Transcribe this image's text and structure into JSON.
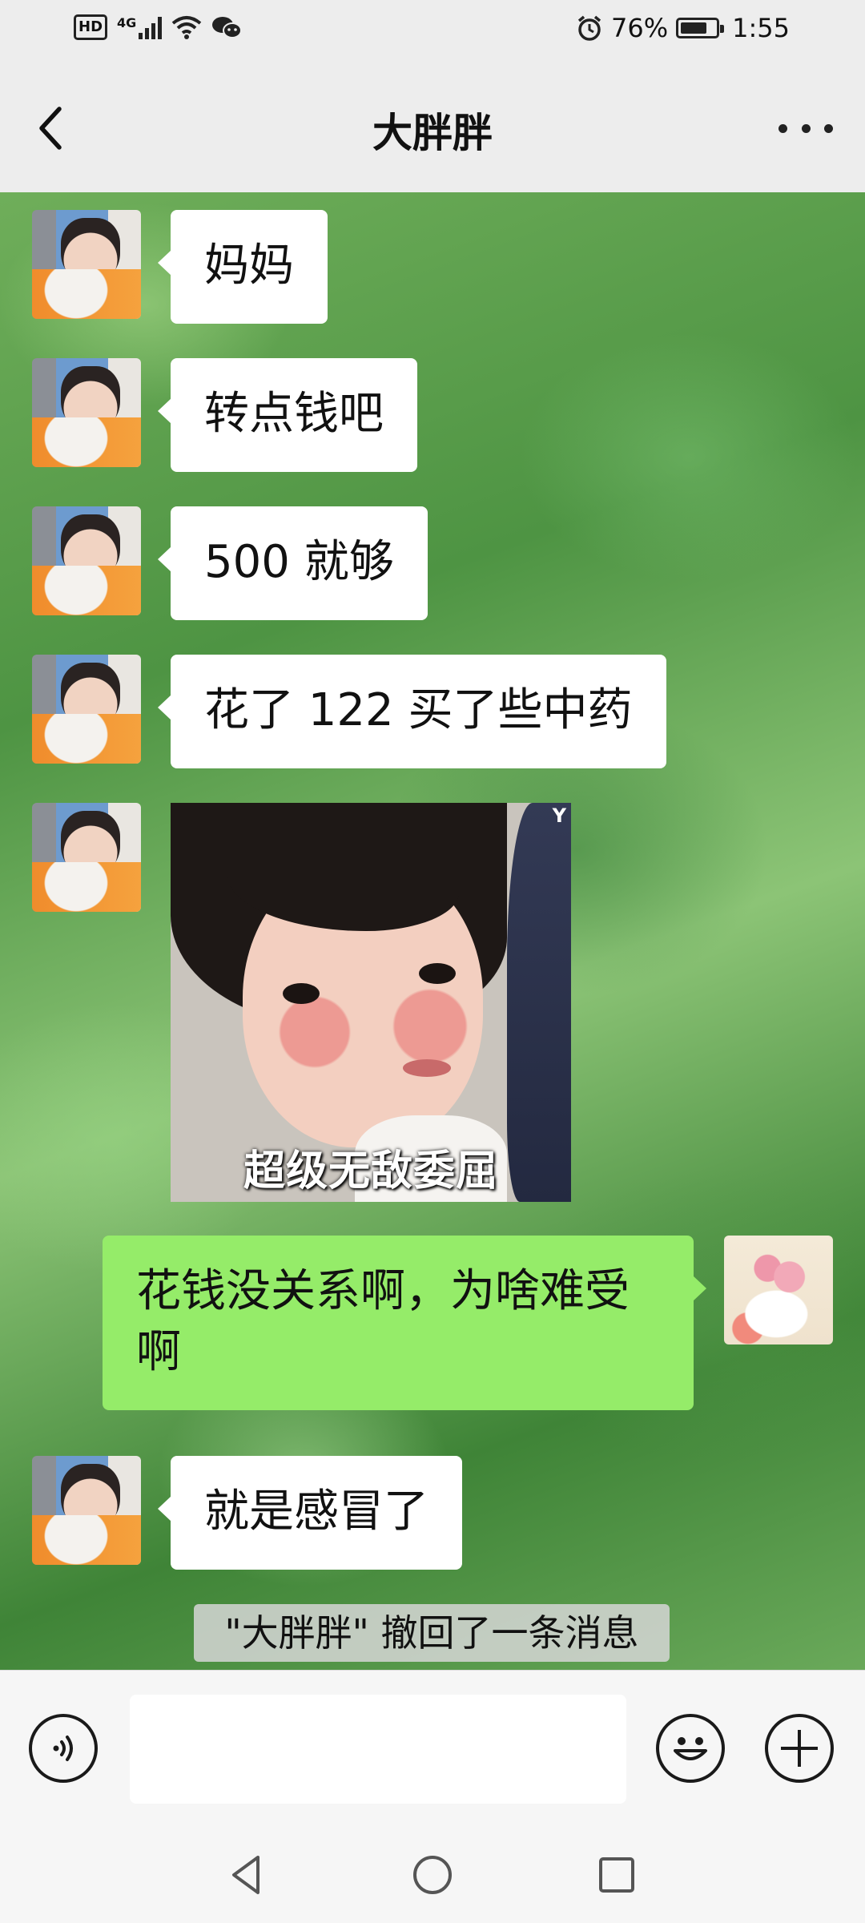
{
  "status_bar": {
    "hd_label": "HD",
    "network_label": "4G",
    "battery_percent": "76%",
    "battery_level": 0.76,
    "time": "1:55"
  },
  "nav": {
    "title": "大胖胖"
  },
  "messages": [
    {
      "sender": "them",
      "type": "text",
      "text": "妈妈"
    },
    {
      "sender": "them",
      "type": "text",
      "text": "转点钱吧"
    },
    {
      "sender": "them",
      "type": "text",
      "text": "500 就够"
    },
    {
      "sender": "them",
      "type": "text",
      "text": "花了 122 买了些中药"
    },
    {
      "sender": "them",
      "type": "sticker",
      "caption": "超级无敌委屈",
      "watermark": "Y"
    },
    {
      "sender": "me",
      "type": "text",
      "text": "花钱没关系啊，为啥难受啊"
    },
    {
      "sender": "them",
      "type": "text",
      "text": "就是感冒了"
    }
  ],
  "system_notice": "\"大胖胖\" 撤回了一条消息",
  "input_bar": {
    "text_value": "",
    "icons": [
      "voice-icon",
      "emoji-icon",
      "plus-icon"
    ]
  },
  "system_nav": {
    "icons": [
      "back-triangle-icon",
      "home-circle-icon",
      "recents-square-icon"
    ]
  },
  "colors": {
    "my_bubble": "#95ec69",
    "their_bubble": "#ffffff",
    "bar_background": "#ededed"
  }
}
